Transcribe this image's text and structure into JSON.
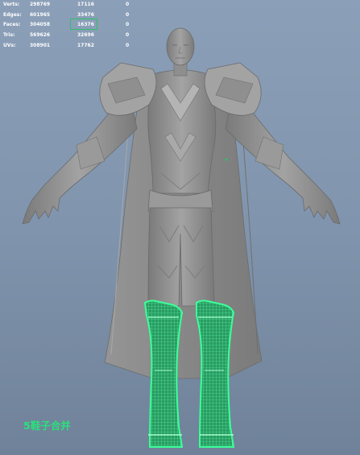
{
  "hud": {
    "rows": [
      {
        "label": "Verts:",
        "values": [
          "298769",
          "17116",
          "0"
        ]
      },
      {
        "label": "Edges:",
        "values": [
          "601965",
          "33476",
          "0"
        ]
      },
      {
        "label": "Faces:",
        "values": [
          "304058",
          "16376",
          "0"
        ]
      },
      {
        "label": "Tris:",
        "values": [
          "569626",
          "32696",
          "0"
        ]
      },
      {
        "label": "UVs:",
        "values": [
          "308901",
          "17762",
          "0"
        ]
      }
    ],
    "highlight_color": "#2fbf6a"
  },
  "viewport": {
    "background_top": "#8b9fb8",
    "background_bottom": "#6f8299",
    "model_color": "#8d8d8d",
    "selection_color": "#2dff88",
    "selected_part": "boots"
  },
  "caption": {
    "text": "5鞋子合并",
    "color": "#28e27a"
  }
}
